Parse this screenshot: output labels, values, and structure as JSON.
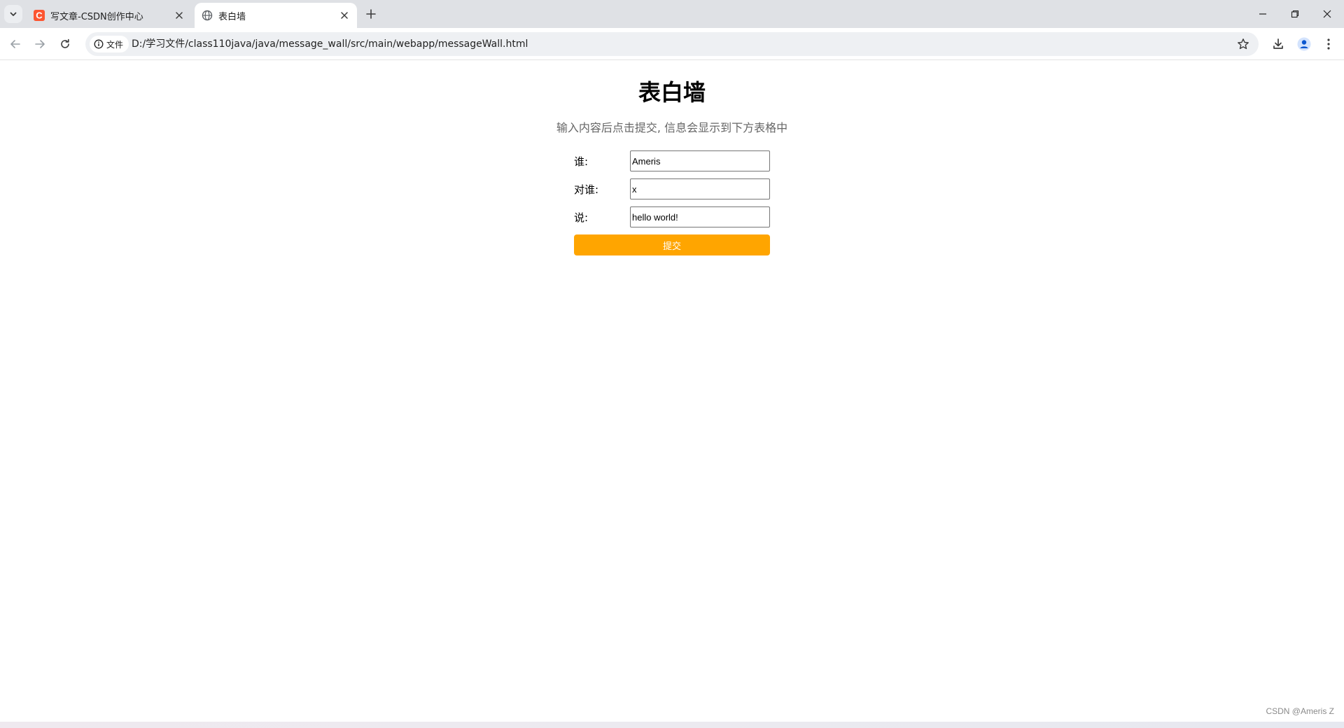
{
  "browser": {
    "tabs": [
      {
        "title": "写文章-CSDN创作中心",
        "favicon": "csdn-c-icon",
        "favicon_color": "#fc5531",
        "active": false
      },
      {
        "title": "表白墙",
        "favicon": "globe-icon",
        "active": true
      }
    ],
    "address_bar": {
      "security_chip": "文件",
      "url": "D:/学习文件/class110java/java/message_wall/src/main/webapp/messageWall.html"
    }
  },
  "page": {
    "title": "表白墙",
    "subtitle": "输入内容后点击提交, 信息会显示到下方表格中",
    "form": {
      "fields": [
        {
          "label": "谁:",
          "value": "Ameris"
        },
        {
          "label": "对谁:",
          "value": "x"
        },
        {
          "label": "说:",
          "value": "hello world!"
        }
      ],
      "submit_label": "提交",
      "submit_color": "#ffa500"
    }
  },
  "watermark": "CSDN @Ameris Z"
}
